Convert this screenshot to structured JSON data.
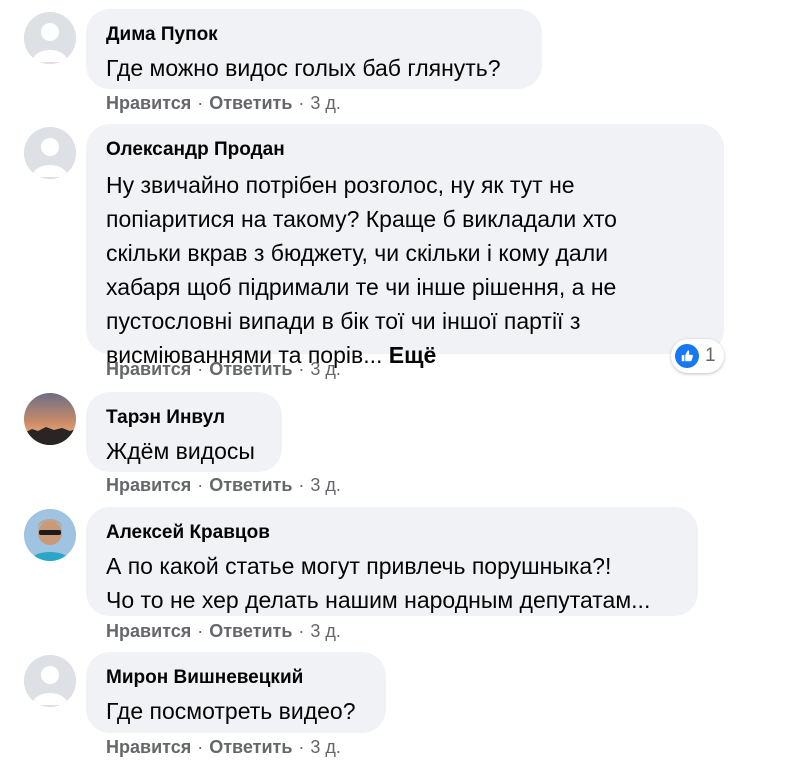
{
  "comments": [
    {
      "author": "Дима Пупок",
      "lines": [
        "Где можно видос голых баб глянуть?"
      ],
      "avatar": "default-avatar",
      "actions": {
        "like": "Нравится",
        "reply": "Ответить",
        "time": "3 д."
      }
    },
    {
      "author": "Олександр Продан",
      "lines": [
        "Ну звичайно потрібен розголос, ну як тут не",
        "попіаритися на такому? Краще б викладали хто",
        "скільки вкрав з бюджету, чи скільки і кому дали",
        "хабаря щоб підримали те чи інше рішення, а не",
        "пустословні випади в бік тої чи іншої партії з",
        "висміюваннями та порів..."
      ],
      "more": "Ещё",
      "avatar": "default-avatar",
      "reaction": {
        "icon": "thumbs-up-icon",
        "count": "1",
        "color": "#1877f2"
      },
      "actions": {
        "like": "Нравится",
        "reply": "Ответить",
        "time": "3 д."
      }
    },
    {
      "author": "Тарэн Инвул",
      "lines": [
        "Ждём видосы"
      ],
      "avatar": "sunset-photo-avatar",
      "actions": {
        "like": "Нравится",
        "reply": "Ответить",
        "time": "3 д."
      }
    },
    {
      "author": "Алексей Кравцов",
      "lines": [
        "А по какой статье могут привлечь порушныка?!",
        "Чо то не хер делать нашим народным депутатам..."
      ],
      "avatar": "person-sunglasses-avatar",
      "actions": {
        "like": "Нравится",
        "reply": "Ответить",
        "time": "3 д."
      }
    },
    {
      "author": "Мирон Вишневецкий",
      "lines": [
        "Где посмотреть видео?"
      ],
      "avatar": "default-avatar",
      "actions": {
        "like": "Нравится",
        "reply": "Ответить",
        "time": "3 д."
      }
    }
  ],
  "colors": {
    "bubble": "#f0f2f5",
    "meta": "#65676b",
    "accent": "#1877f2"
  }
}
